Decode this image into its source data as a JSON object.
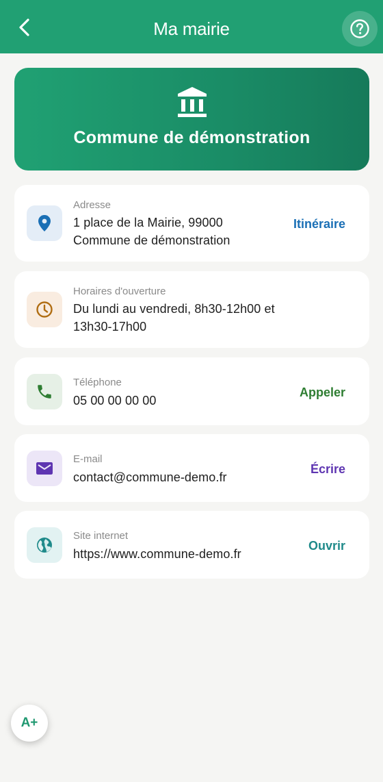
{
  "header": {
    "title": "Ma mairie",
    "back_icon": "chevron-left-icon",
    "help_icon": "help-circle-icon"
  },
  "hero": {
    "icon": "city-hall-icon",
    "title": "Commune de démonstration"
  },
  "cards": {
    "address": {
      "label": "Adresse",
      "line1": "1 place de la Mairie, 99000",
      "line2": "Commune de démonstration",
      "action": "Itinéraire",
      "icon": "map-pin-icon"
    },
    "hours": {
      "label": "Horaires d'ouverture",
      "line1": "Du lundi au vendredi, 8h30-12h00 et",
      "line2": "13h30-17h00",
      "icon": "clock-icon"
    },
    "phone": {
      "label": "Téléphone",
      "value": "05 00 00 00 00",
      "action": "Appeler",
      "icon": "phone-icon"
    },
    "email": {
      "label": "E-mail",
      "value": "contact@commune-demo.fr",
      "action": "Écrire",
      "icon": "mail-icon"
    },
    "website": {
      "label": "Site internet",
      "value": "https://www.commune-demo.fr",
      "action": "Ouvrir",
      "icon": "globe-icon"
    }
  },
  "accessibility": {
    "font_size_label": "A+"
  },
  "colors": {
    "brand": "#21a073",
    "blue": "#1a6fb5",
    "brown": "#b06d12",
    "green": "#2e7d32",
    "purple": "#5e35b1",
    "teal": "#1f8a8a"
  }
}
